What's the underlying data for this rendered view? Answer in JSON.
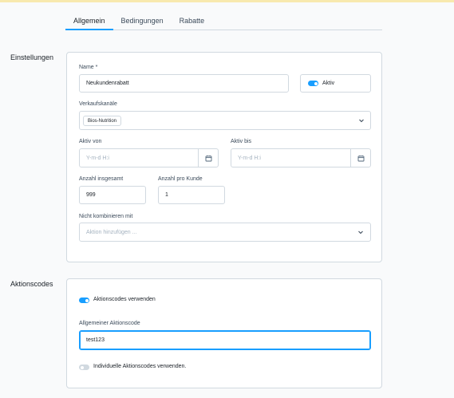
{
  "tabs": [
    {
      "label": "Allgemein",
      "active": true
    },
    {
      "label": "Bedingungen",
      "active": false
    },
    {
      "label": "Rabatte",
      "active": false
    }
  ],
  "settings": {
    "section_title": "Einstellungen",
    "name_label": "Name *",
    "name_value": "Neukundenrabatt",
    "active_label": "Aktiv",
    "active_on": true,
    "channels_label": "Verkaufskanäle",
    "channels_selected": [
      "Bios-Nutrition"
    ],
    "active_from_label": "Aktiv von",
    "active_from_placeholder": "Y-m-d H:i",
    "active_until_label": "Aktiv bis",
    "active_until_placeholder": "Y-m-d H:i",
    "total_label": "Anzahl insgesamt",
    "total_value": "999",
    "per_customer_label": "Anzahl pro Kunde",
    "per_customer_value": "1",
    "no_combine_label": "Nicht kombinieren mit",
    "no_combine_placeholder": "Aktion hinzufügen ..."
  },
  "codes": {
    "section_title": "Aktionscodes",
    "use_codes_label": "Aktionscodes verwenden",
    "use_codes_on": true,
    "general_code_label": "Allgemeiner Aktionscode",
    "general_code_value": "test123",
    "individual_codes_label": "Individuelle Aktionscodes verwenden.",
    "individual_codes_on": false
  },
  "colors": {
    "accent": "#189eff",
    "border": "#d1d9e0",
    "top_bar": "#f8e9ae"
  }
}
